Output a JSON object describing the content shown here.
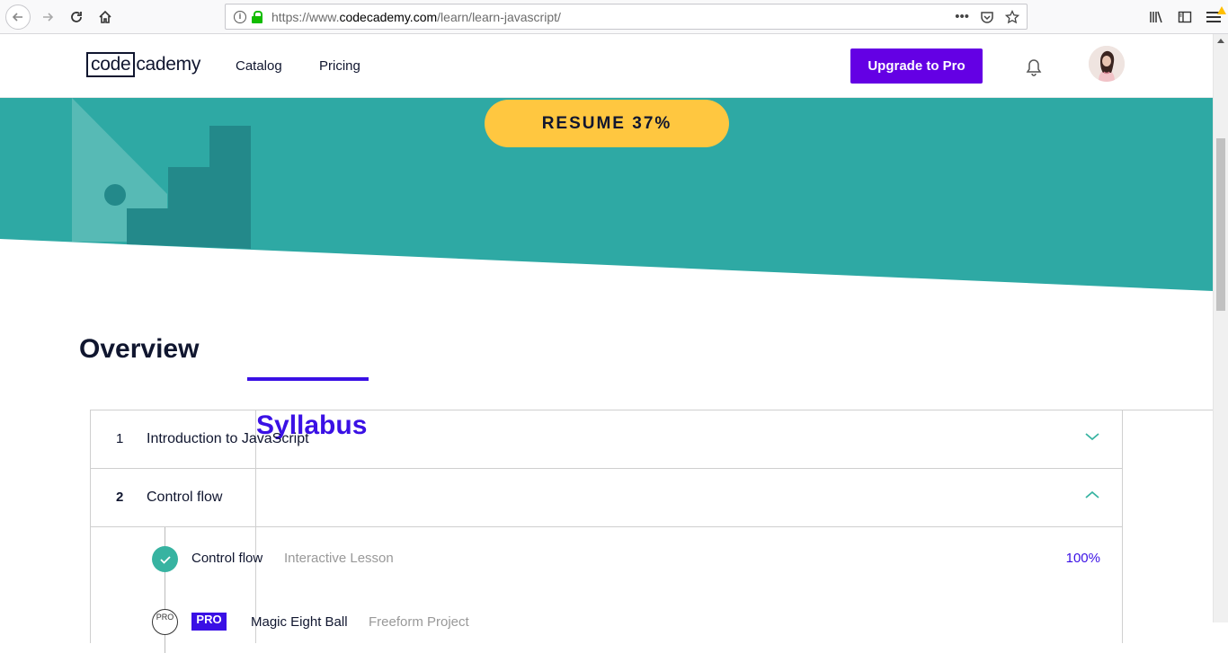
{
  "browser": {
    "url_prefix": "https://www.",
    "url_domain": "codecademy.com",
    "url_path": "/learn/learn-javascript/"
  },
  "header": {
    "logo_boxed": "code",
    "logo_rest": "cademy",
    "nav": [
      "Catalog",
      "Pricing"
    ],
    "upgrade_label": "Upgrade to Pro"
  },
  "hero": {
    "resume_label": "RESUME 37%",
    "accent_color": "#2ea9a4"
  },
  "tabs": [
    {
      "label": "Overview",
      "active": false
    },
    {
      "label": "Syllabus",
      "active": true
    }
  ],
  "syllabus": {
    "modules": [
      {
        "number": "1",
        "title": "Introduction to JavaScript",
        "expanded": false
      },
      {
        "number": "2",
        "title": "Control flow",
        "expanded": true
      }
    ],
    "items": [
      {
        "title": "Control flow",
        "type": "Interactive Lesson",
        "progress": "100%",
        "status": "complete"
      },
      {
        "title": "Magic Eight Ball",
        "type": "Freeform Project",
        "badge": "PRO",
        "icon_label": "PRO",
        "status": "locked"
      }
    ]
  },
  "colors": {
    "brand_purple": "#6400e4",
    "syllabus_blue": "#3a10e5",
    "resume_yellow": "#ffc740",
    "teal": "#37b3a1"
  }
}
